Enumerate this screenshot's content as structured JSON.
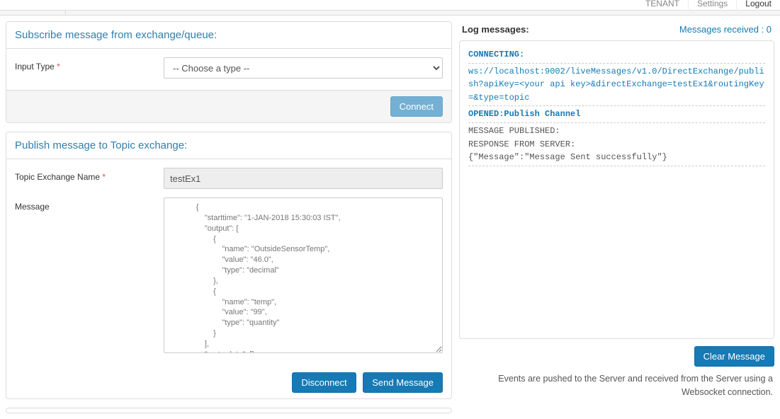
{
  "topnav": {
    "tenant": "TENANT",
    "settings": "Settings",
    "logout": "Logout"
  },
  "subscribe": {
    "title": "Subscribe message from exchange/queue:",
    "input_type_label": "Input Type",
    "select_placeholder": "-- Choose a type --",
    "connect_btn": "Connect"
  },
  "publish": {
    "title": "Publish message to Topic exchange:",
    "exchange_label": "Topic Exchange Name",
    "exchange_value": "testEx1",
    "message_label": "Message",
    "message_value": "            {\n                \"starttime\": \"1-JAN-2018 15:30:03 IST\",\n                \"output\": [\n                    {\n                        \"name\": \"OutsideSensorTemp\",\n                        \"value\": \"46.0\",\n                        \"type\": \"decimal\"\n                    },\n                    {\n                        \"name\": \"temp\",\n                        \"value\": \"99\",\n                        \"type\": \"quantity\"\n                    }\n                ],\n                \"meta-data\": []\n            }\n        ]\n    }",
    "disconnect_btn": "Disconnect",
    "send_btn": "Send Message"
  },
  "log": {
    "title": "Log messages:",
    "received_label": "Messages received : 0",
    "connecting": "CONNECTING:",
    "url": "ws://localhost:9002/liveMessages/v1.0/DirectExchange/publish?apiKey=<your api key>&directExchange=testEx1&routingKey=&type=topic",
    "opened": "OPENED:Publish Channel",
    "published": "MESSAGE PUBLISHED:",
    "response": "RESPONSE FROM SERVER:",
    "body": "{\"Message\":\"Message Sent successfully\"}",
    "clear_btn": "Clear Message",
    "footer_note": "Events are pushed to the Server and received from the Server using a Websocket connection."
  }
}
